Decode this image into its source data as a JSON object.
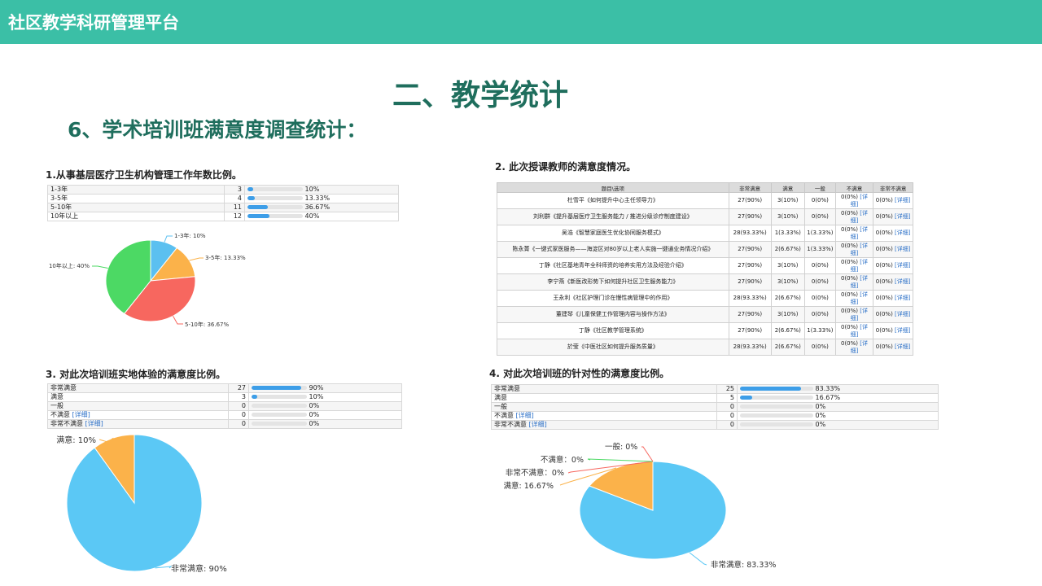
{
  "header": {
    "app_title": "社区教学科研管理平台"
  },
  "page": {
    "title": "二、教学统计",
    "subtitle": "6、学术培训班满意度调查统计："
  },
  "section1": {
    "title": "1.从事基层医疗卫生机构管理工作年数比例。",
    "rows": [
      {
        "label": "1-3年",
        "count": "3",
        "pct": "10%",
        "frac": 0.1
      },
      {
        "label": "3-5年",
        "count": "4",
        "pct": "13.33%",
        "frac": 0.1333
      },
      {
        "label": "5-10年",
        "count": "11",
        "pct": "36.67%",
        "frac": 0.3667
      },
      {
        "label": "10年以上",
        "count": "12",
        "pct": "40%",
        "frac": 0.4
      }
    ]
  },
  "section2": {
    "title": "2. 此次授课教师的满意度情况。",
    "headers": [
      "题目\\选项",
      "非常满意",
      "满意",
      "一般",
      "不满意",
      "非常不满意"
    ],
    "detail_link": "[详细]",
    "rows": [
      {
        "course": "杜雪平《如何提升中心主任领导力》",
        "c1": "27(90%)",
        "c2": "3(10%)",
        "c3": "0(0%)",
        "c4": "0(0%)",
        "c5": "0(0%)"
      },
      {
        "course": "刘利群《提升基层医疗卫生服务能力 / 推进分级诊疗制度建设》",
        "c1": "27(90%)",
        "c2": "3(10%)",
        "c3": "0(0%)",
        "c4": "0(0%)",
        "c5": "0(0%)"
      },
      {
        "course": "吴浩《智慧家庭医生优化协同服务模式》",
        "c1": "28(93.33%)",
        "c2": "1(3.33%)",
        "c3": "1(3.33%)",
        "c4": "0(0%)",
        "c5": "0(0%)"
      },
      {
        "course": "陈永菁《一键式家医服务——海淀区对80岁以上老人实施一键通业务情况介绍》",
        "c1": "27(90%)",
        "c2": "2(6.67%)",
        "c3": "1(3.33%)",
        "c4": "0(0%)",
        "c5": "0(0%)"
      },
      {
        "course": "丁静《社区基地青年全科师资的培养实用方法及经验介绍》",
        "c1": "27(90%)",
        "c2": "3(10%)",
        "c3": "0(0%)",
        "c4": "0(0%)",
        "c5": "0(0%)"
      },
      {
        "course": "李宁燕《新医改形势下如何提升社区卫生服务能力》",
        "c1": "27(90%)",
        "c2": "3(10%)",
        "c3": "0(0%)",
        "c4": "0(0%)",
        "c5": "0(0%)"
      },
      {
        "course": "王永利《社区护理门诊在慢性病管理中的作用》",
        "c1": "28(93.33%)",
        "c2": "2(6.67%)",
        "c3": "0(0%)",
        "c4": "0(0%)",
        "c5": "0(0%)"
      },
      {
        "course": "董建琴《儿童保健工作管理内容与操作方法》",
        "c1": "27(90%)",
        "c2": "3(10%)",
        "c3": "0(0%)",
        "c4": "0(0%)",
        "c5": "0(0%)"
      },
      {
        "course": "丁静《社区教学管理系统》",
        "c1": "27(90%)",
        "c2": "2(6.67%)",
        "c3": "1(3.33%)",
        "c4": "0(0%)",
        "c5": "0(0%)"
      },
      {
        "course": "於莹《中医社区如何提升服务质量》",
        "c1": "28(93.33%)",
        "c2": "2(6.67%)",
        "c3": "0(0%)",
        "c4": "0(0%)",
        "c5": "0(0%)"
      }
    ]
  },
  "section3": {
    "title": "3. 对此次培训班实地体验的满意度比例。",
    "rows": [
      {
        "label": "非常满意",
        "count": "27",
        "pct": "90%",
        "frac": 0.9,
        "link": ""
      },
      {
        "label": "满意",
        "count": "3",
        "pct": "10%",
        "frac": 0.1,
        "link": ""
      },
      {
        "label": "一般",
        "count": "0",
        "pct": "0%",
        "frac": 0,
        "link": ""
      },
      {
        "label": "不满意",
        "count": "0",
        "pct": "0%",
        "frac": 0,
        "link": "[详细]"
      },
      {
        "label": "非常不满意",
        "count": "0",
        "pct": "0%",
        "frac": 0,
        "link": "[详细]"
      }
    ]
  },
  "section4": {
    "title": "4. 对此次培训班的针对性的满意度比例。",
    "rows": [
      {
        "label": "非常满意",
        "count": "25",
        "pct": "83.33%",
        "frac": 0.8333,
        "link": ""
      },
      {
        "label": "满意",
        "count": "5",
        "pct": "16.67%",
        "frac": 0.1667,
        "link": ""
      },
      {
        "label": "一般",
        "count": "0",
        "pct": "0%",
        "frac": 0,
        "link": ""
      },
      {
        "label": "不满意",
        "count": "0",
        "pct": "0%",
        "frac": 0,
        "link": "[详细]"
      },
      {
        "label": "非常不满意",
        "count": "0",
        "pct": "0%",
        "frac": 0,
        "link": "[详细]"
      }
    ]
  },
  "chart_data": [
    {
      "type": "pie",
      "slices": [
        {
          "label": "1-3年: 10%",
          "value": 10,
          "color": "#5bc0f0"
        },
        {
          "label": "3-5年: 13.33%",
          "value": 13.33,
          "color": "#fbb24a"
        },
        {
          "label": "5-10年: 36.67%",
          "value": 36.67,
          "color": "#f7675f"
        },
        {
          "label": "10年以上: 40%",
          "value": 40,
          "color": "#4cd964"
        }
      ]
    },
    {
      "type": "pie",
      "slices": [
        {
          "label": "非常满意: 90%",
          "value": 90,
          "color": "#5bc8f5"
        },
        {
          "label": "满意: 10%",
          "value": 10,
          "color": "#fbb24a"
        }
      ]
    },
    {
      "type": "pie",
      "slices": [
        {
          "label": "非常满意: 83.33%",
          "value": 83.33,
          "color": "#5bc8f5"
        },
        {
          "label": "满意: 16.67%",
          "value": 16.67,
          "color": "#fbb24a"
        },
        {
          "label": "非常不满意：0%",
          "value": 0,
          "color": "#f7675f"
        },
        {
          "label": "不满意：0%",
          "value": 0,
          "color": "#4cd964"
        },
        {
          "label": "一般: 0%",
          "value": 0,
          "color": "#f7675f"
        }
      ]
    }
  ]
}
